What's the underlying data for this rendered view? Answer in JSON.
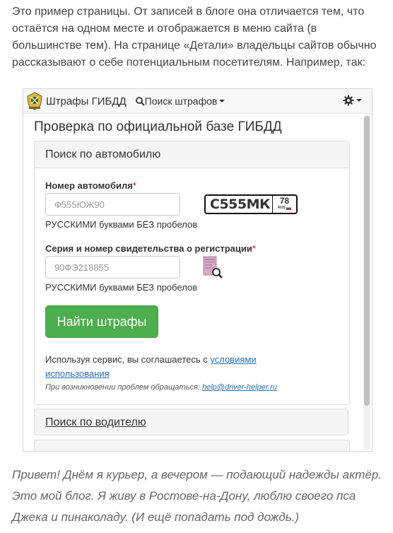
{
  "intro_text": "Это пример страницы. От записей в блоге она отличается тем, что остаётся на одном месте и отображается в меню сайта (в большинстве тем). На странице «Детали» владельцы сайтов обычно рассказывают о себе потенциальным посетителям. Например, так:",
  "navbar": {
    "brand": "Штрафы ГИБДД",
    "search_menu": "Поиск штрафов"
  },
  "page_title": "Проверка по официальной базе ГИБДД",
  "car_panel": {
    "heading": "Поиск по автомобилю",
    "plate_label": "Номер автомобиля",
    "plate_placeholder": "Ф555ЮЖ90",
    "plate_hint": "РУССКИМИ буквами БЕЗ пробелов",
    "plate_example": {
      "number": "С555МК",
      "region": "78",
      "country": "RUS"
    },
    "cert_label": "Серия и номер свидетельства о регистрации",
    "cert_placeholder": "90ФЭ218855",
    "cert_hint": "РУССКИМИ буквами БЕЗ пробелов",
    "required_mark": "*",
    "submit_label": "Найти штрафы",
    "agree_text": "Используя сервис, вы соглашаетесь с ",
    "agree_link": "условиями использования",
    "contact_text": "При возникновении проблем обращаться: ",
    "contact_email": "help@driver-helper.ru"
  },
  "driver_panel": {
    "heading": "Поиск по водителю"
  },
  "outro_text": "Привет! Днём я курьер, а вечером — подающий надежды актёр. Это мой блог. Я живу в Ростове-на-Дону, люблю своего пса Джека и пинаколаду. (И ещё попадать под дождь.)",
  "colors": {
    "button": "#4cae4c",
    "link": "#2a6eb8",
    "required": "#cc0000"
  }
}
